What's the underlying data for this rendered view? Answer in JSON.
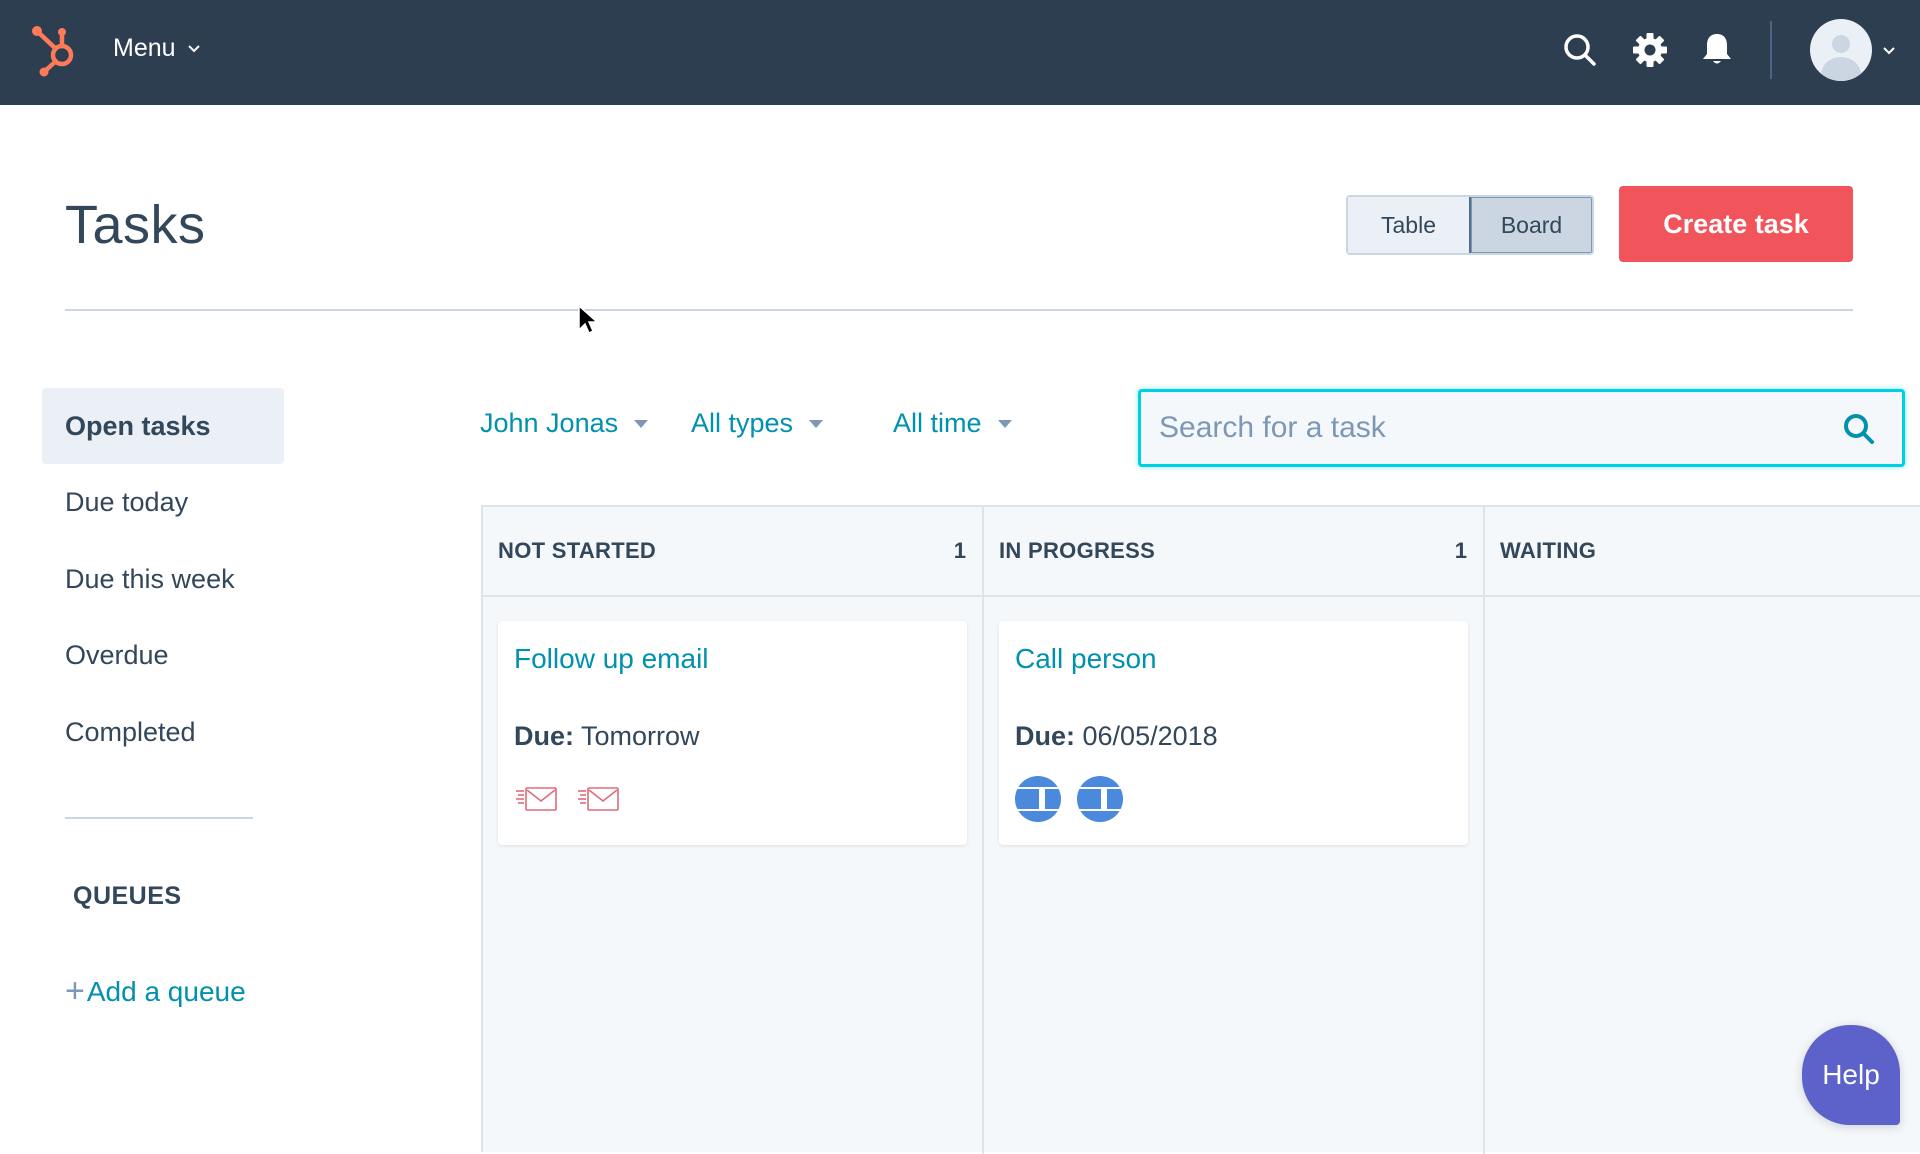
{
  "topbar": {
    "logo": "hubspot-sprocket-logo",
    "menu_label": "Menu",
    "icons": [
      "search-icon",
      "gear-icon",
      "bell-icon"
    ],
    "avatar": "user-avatar",
    "colors": {
      "background": "#2d3e50",
      "logo": "#ff7a59"
    }
  },
  "page": {
    "title": "Tasks",
    "view_toggle": {
      "options": [
        "Table",
        "Board"
      ],
      "selected": "Board"
    },
    "create_button": "Create task"
  },
  "sidebar": {
    "items": [
      {
        "label": "Open tasks",
        "active": true
      },
      {
        "label": "Due today",
        "active": false
      },
      {
        "label": "Due this week",
        "active": false
      },
      {
        "label": "Overdue",
        "active": false
      },
      {
        "label": "Completed",
        "active": false
      }
    ],
    "queues_heading": "QUEUES",
    "add_queue_plus": "+",
    "add_queue_label": "Add a queue"
  },
  "filters": {
    "owner": "John Jonas",
    "type": "All types",
    "time": "All time"
  },
  "search": {
    "placeholder": "Search for a task",
    "value": ""
  },
  "board": {
    "columns": [
      {
        "title": "NOT STARTED",
        "count": "1",
        "cards": [
          {
            "title": "Follow up email",
            "due_label": "Due:",
            "due_value": "Tomorrow",
            "icons": [
              "email-icon",
              "email-icon"
            ]
          }
        ]
      },
      {
        "title": "IN PROGRESS",
        "count": "1",
        "cards": [
          {
            "title": "Call person",
            "due_label": "Due:",
            "due_value": "06/05/2018",
            "icons": [
              "in-progress-icon",
              "in-progress-icon"
            ]
          }
        ]
      },
      {
        "title": "WAITING",
        "count": "",
        "cards": []
      }
    ]
  },
  "help_button": "Help",
  "colors": {
    "accent_link": "#0091ae",
    "primary_button": "#f2545b",
    "help_button": "#5c62c9",
    "search_focus": "#00d0e4",
    "in_progress_icon": "#4a89dc",
    "email_icon": "#e06b7a"
  }
}
